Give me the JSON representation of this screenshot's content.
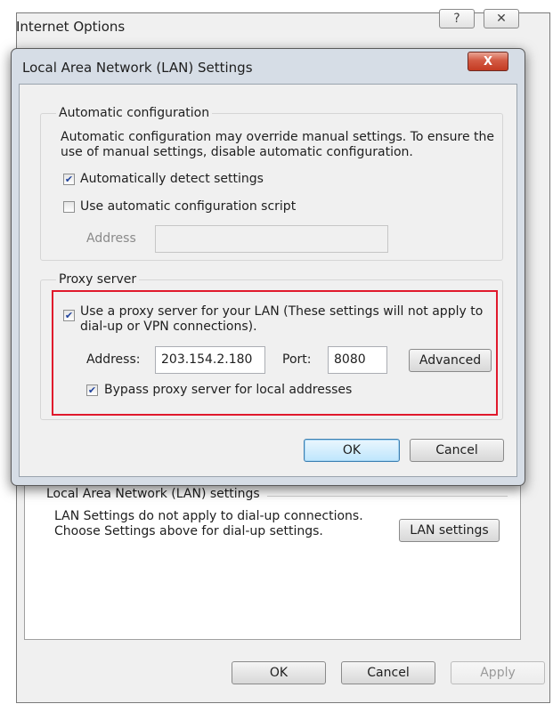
{
  "parent_window": {
    "title": "Internet Options",
    "help_glyph": "?",
    "close_glyph": "✕",
    "lan_group": {
      "label": "Local Area Network (LAN) settings",
      "description": "LAN Settings do not apply to dial-up connections. Choose Settings above for dial-up settings.",
      "button": "LAN settings"
    },
    "buttons": {
      "ok": "OK",
      "cancel": "Cancel",
      "apply": "Apply"
    }
  },
  "dialog": {
    "title": "Local Area Network (LAN) Settings",
    "close_glyph": "X",
    "automatic_configuration": {
      "group_title": "Automatic configuration",
      "description": "Automatic configuration may override manual settings.  To ensure the use of manual settings, disable automatic configuration.",
      "detect_settings": {
        "label": "Automatically detect settings",
        "checked": true
      },
      "config_script": {
        "label": "Use automatic configuration script",
        "checked": false
      },
      "address_label": "Address",
      "address_value": ""
    },
    "proxy_server": {
      "group_title": "Proxy server",
      "use_proxy": {
        "label": "Use a proxy server for your LAN (These settings will not apply to dial-up or VPN connections).",
        "checked": true
      },
      "address_label": "Address:",
      "address_value": "203.154.2.180",
      "port_label": "Port:",
      "port_value": "8080",
      "advanced_button": "Advanced",
      "bypass_local": {
        "label": "Bypass proxy server for local addresses",
        "checked": true
      }
    },
    "buttons": {
      "ok": "OK",
      "cancel": "Cancel"
    }
  },
  "colors": {
    "highlight_border": "#e0192c",
    "close_button": "#c43b22",
    "checkmark": "#21439c"
  }
}
